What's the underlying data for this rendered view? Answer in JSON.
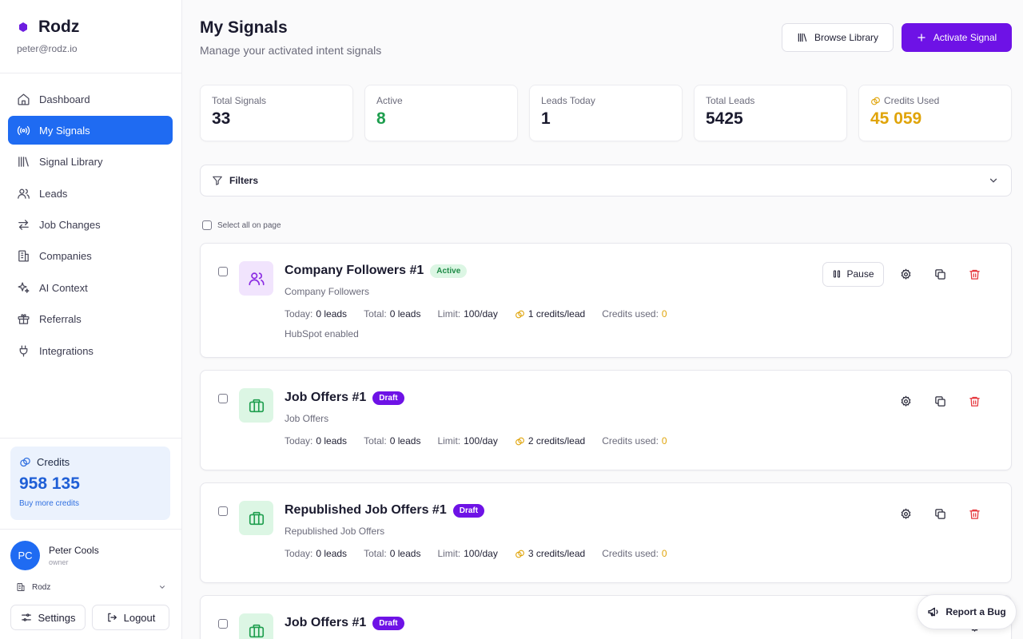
{
  "sidebar": {
    "brand": "Rodz",
    "email": "peter@rodz.io",
    "nav": [
      {
        "label": "Dashboard",
        "icon": "home-icon"
      },
      {
        "label": "My Signals",
        "icon": "radio-signal-icon"
      },
      {
        "label": "Signal Library",
        "icon": "library-icon"
      },
      {
        "label": "Leads",
        "icon": "users-icon"
      },
      {
        "label": "Job Changes",
        "icon": "arrows-exchange-icon"
      },
      {
        "label": "Companies",
        "icon": "building-icon"
      },
      {
        "label": "AI Context",
        "icon": "sparkles-icon"
      },
      {
        "label": "Referrals",
        "icon": "gift-icon"
      },
      {
        "label": "Integrations",
        "icon": "plug-icon"
      }
    ],
    "credits": {
      "label": "Credits",
      "value": "958 135",
      "link": "Buy more credits"
    },
    "user": {
      "initials": "PC",
      "name": "Peter Cools",
      "role": "owner"
    },
    "org": "Rodz",
    "settings": "Settings",
    "logout": "Logout"
  },
  "header": {
    "title": "My Signals",
    "subtitle": "Manage your activated intent signals",
    "browse": "Browse Library",
    "activate": "Activate Signal"
  },
  "stats": [
    {
      "label": "Total Signals",
      "value": "33"
    },
    {
      "label": "Active",
      "value": "8"
    },
    {
      "label": "Leads Today",
      "value": "1"
    },
    {
      "label": "Total Leads",
      "value": "5425"
    },
    {
      "label": "Credits Used",
      "value": "45 059"
    }
  ],
  "filters": {
    "label": "Filters"
  },
  "select_all": "Select all on page",
  "meta_labels": {
    "today": "Today:",
    "total": "Total:",
    "limit": "Limit:",
    "credits_used": "Credits used:"
  },
  "signals": [
    {
      "name": "Company Followers #1",
      "status": "Active",
      "type": "Company Followers",
      "today": "0 leads",
      "total": "0 leads",
      "limit": "100/day",
      "cost": "1 credits/lead",
      "used": "0",
      "extra": "HubSpot enabled",
      "pause": "Pause"
    },
    {
      "name": "Job Offers #1",
      "status": "Draft",
      "type": "Job Offers",
      "today": "0 leads",
      "total": "0 leads",
      "limit": "100/day",
      "cost": "2 credits/lead",
      "used": "0"
    },
    {
      "name": "Republished Job Offers #1",
      "status": "Draft",
      "type": "Republished Job Offers",
      "today": "0 leads",
      "total": "0 leads",
      "limit": "100/day",
      "cost": "3 credits/lead",
      "used": "0"
    },
    {
      "name": "Job Offers #1",
      "status": "Draft"
    }
  ],
  "report_bug": "Report a Bug",
  "colors": {
    "accent_blue": "#1f6bf2",
    "accent_purple": "#6e12e6",
    "active_green": "#1e8a46",
    "credits_yellow": "#e0a40a",
    "delete_red": "#e5353b"
  }
}
